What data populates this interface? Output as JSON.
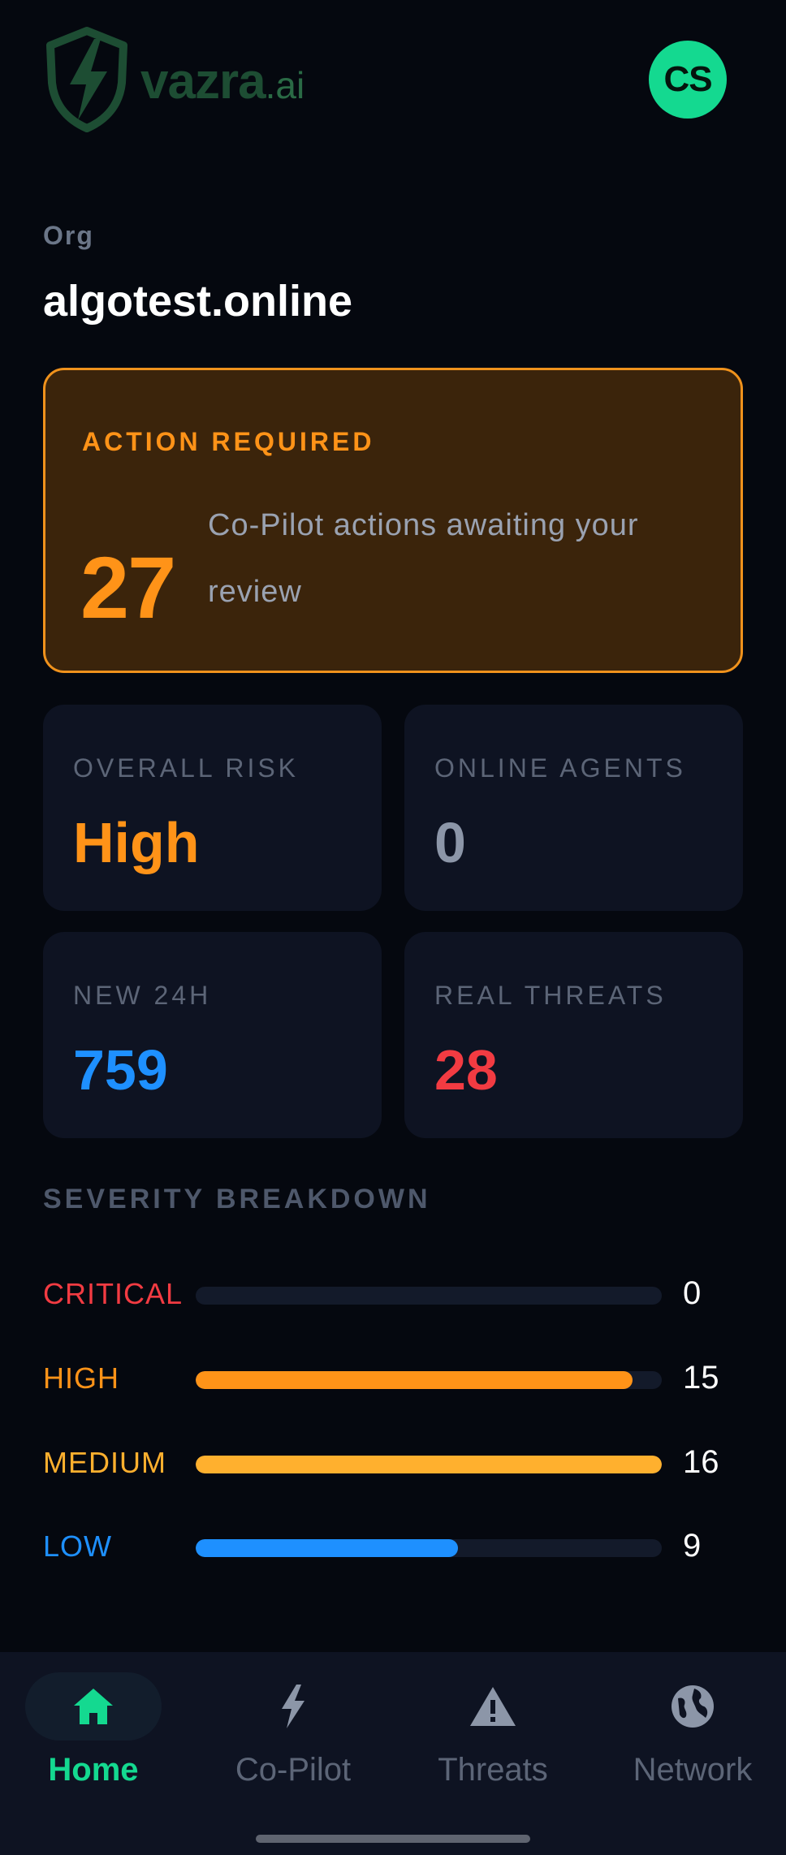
{
  "header": {
    "logo_name": "vazra",
    "logo_tld": ".ai",
    "avatar_initials": "CS",
    "avatar_color": "#14d990"
  },
  "org": {
    "label": "Org",
    "name": "algotest.online"
  },
  "action_card": {
    "title": "ACTION REQUIRED",
    "count": "27",
    "description": "Co-Pilot actions awaiting your review",
    "accent": "#ff9318"
  },
  "stats": {
    "overall_risk": {
      "label": "OVERALL RISK",
      "value": "High",
      "color": "#ff9318"
    },
    "online_agents": {
      "label": "ONLINE AGENTS",
      "value": "0",
      "color": "#8c96a8"
    },
    "new_24h": {
      "label": "NEW 24H",
      "value": "759",
      "color": "#1e90ff"
    },
    "real_threats": {
      "label": "REAL THREATS",
      "value": "28",
      "color": "#f23b42"
    }
  },
  "severity": {
    "title": "SEVERITY BREAKDOWN",
    "max": 16,
    "rows": [
      {
        "label": "CRITICAL",
        "count": "0",
        "value": 0,
        "color": "#f23b42"
      },
      {
        "label": "HIGH",
        "count": "15",
        "value": 15,
        "color": "#ff9318"
      },
      {
        "label": "MEDIUM",
        "count": "16",
        "value": 16,
        "color": "#ffb02e"
      },
      {
        "label": "LOW",
        "count": "9",
        "value": 9,
        "color": "#1e90ff"
      }
    ]
  },
  "nav": {
    "items": [
      {
        "label": "Home",
        "icon": "home-icon",
        "active": true
      },
      {
        "label": "Co-Pilot",
        "icon": "bolt-icon",
        "active": false
      },
      {
        "label": "Threats",
        "icon": "warning-icon",
        "active": false
      },
      {
        "label": "Network",
        "icon": "globe-icon",
        "active": false
      }
    ]
  }
}
